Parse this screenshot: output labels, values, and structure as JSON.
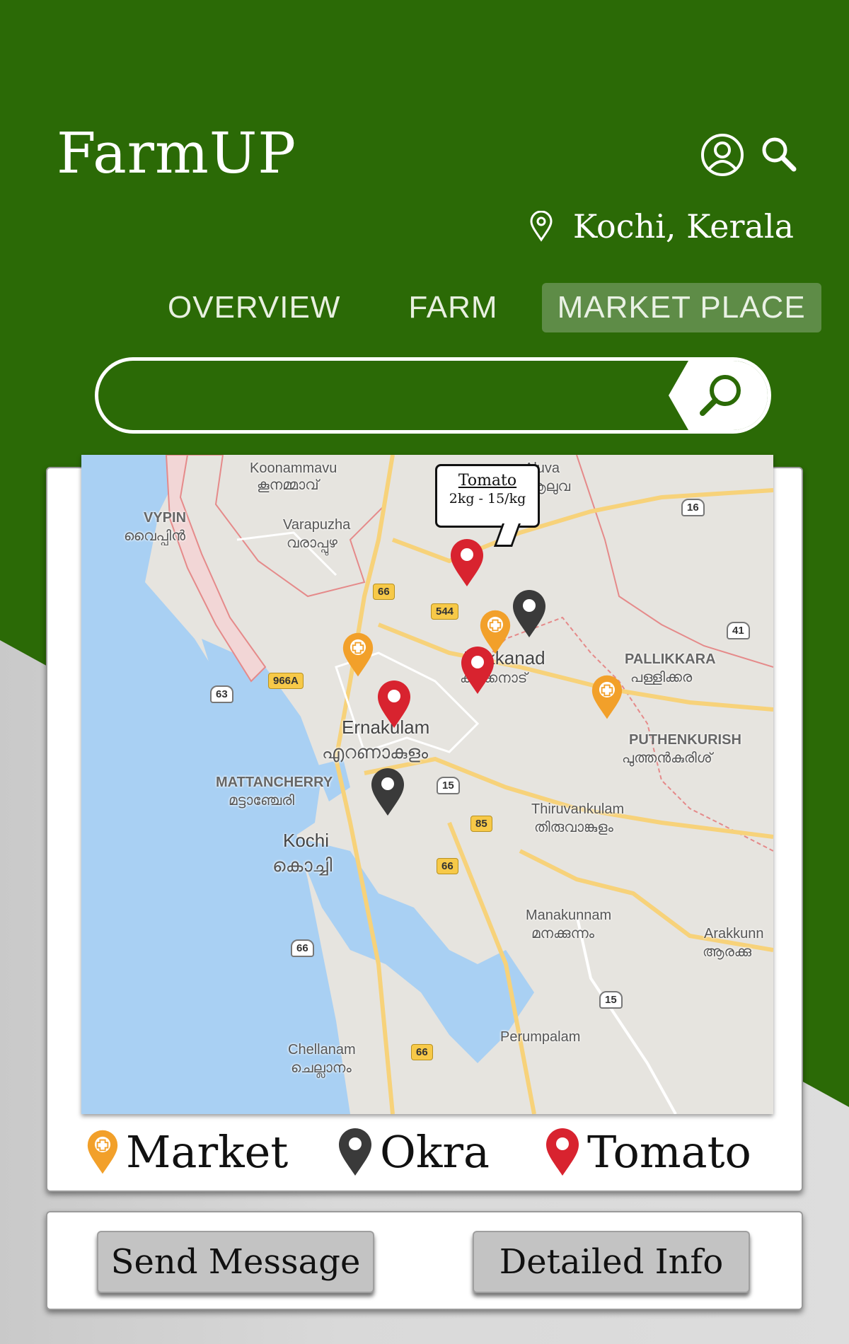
{
  "app": {
    "title": "FarmUP"
  },
  "header": {
    "location": "Kochi, Kerala",
    "icons": {
      "user": "user-icon",
      "search": "search-icon",
      "location": "map-pin-icon"
    }
  },
  "tabs": [
    {
      "label": "OVERVIEW",
      "active": false
    },
    {
      "label": "FARM",
      "active": false
    },
    {
      "label": "MARKET PLACE",
      "active": true
    }
  ],
  "search": {
    "value": "",
    "placeholder": ""
  },
  "map": {
    "tooltip": {
      "title": "Tomato",
      "detail": "2kg - 15/kg"
    },
    "labels": {
      "koonammavu": "Koonammavu",
      "koonammavu_ml": "കൂനമ്മാവ്",
      "aluva": "Aluva",
      "aluva_ml": "ആലുവ",
      "vypin": "VYPIN",
      "vypin_ml": "വൈപ്പിൻ",
      "varapuzha": "Varapuzha",
      "varapuzha_ml": "വരാപ്പുഴ",
      "kakkanad": "Kakkanad",
      "kakkanad_ml": "കാക്കനാട്",
      "pallikkara": "PALLIKKARA",
      "pallikkara_ml": "പള്ളിക്കര",
      "ernakulam": "Ernakulam",
      "ernakulam_ml": "എറണാകുളം",
      "puthenkurish": "PUTHENKURISH",
      "puthenkurish_ml": "പുത്തൻകുരിശ്",
      "mattancherry": "MATTANCHERRY",
      "mattancherry_ml": "മട്ടാഞ്ചേരി",
      "kochi": "Kochi",
      "kochi_ml": "കൊച്ചി",
      "thiruvankulam": "Thiruvankulam",
      "thiruvankulam_ml": "തിരുവാങ്കുളം",
      "manakunnam": "Manakunnam",
      "manakunnam_ml": "മനക്കുന്നം",
      "arakkunnam": "Arakkunn",
      "arakkunnam_ml": "ആരക്കു",
      "chellanam": "Chellanam",
      "chellanam_ml": "ചെല്ലാനം",
      "perumpalam": "Perumpalam"
    },
    "shields": {
      "r16": "16",
      "r66a": "66",
      "r544": "544",
      "r41": "41",
      "r966a": "966A",
      "r63": "63",
      "r15a": "15",
      "r85": "85",
      "r66b": "66",
      "r66c": "66",
      "r15b": "15",
      "r66d": "66"
    },
    "pin_colors": {
      "market": "#f2a02a",
      "okra": "#3a3a3a",
      "tomato": "#d8232f"
    }
  },
  "legend": [
    {
      "label": "Market",
      "icon": "market-pin-icon"
    },
    {
      "label": "Okra",
      "icon": "okra-pin-icon"
    },
    {
      "label": "Tomato",
      "icon": "tomato-pin-icon"
    }
  ],
  "actions": {
    "send_message": "Send Message",
    "detailed_info": "Detailed Info"
  },
  "colors": {
    "brand_green": "#2b6a06",
    "active_tab": "#5e8c47"
  }
}
